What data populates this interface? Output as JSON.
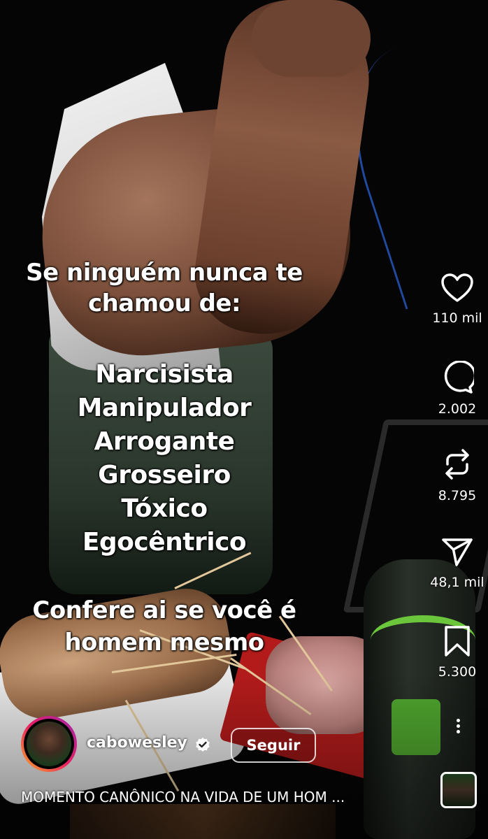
{
  "overlay": {
    "line1": "Se ninguém nunca te",
    "line2": "chamou de:",
    "list": [
      "Narcisista",
      "Manipulador",
      "Arrogante",
      "Grosseiro",
      "Tóxico",
      "Egocêntrico"
    ],
    "closing1": "Confere ai se você é",
    "closing2": "homem mesmo"
  },
  "actions": {
    "likes": "110 mil",
    "comments": "2.002",
    "reposts": "8.795",
    "shares": "48,1 mil",
    "saves": "5.300"
  },
  "author": {
    "username": "cabowesley",
    "verified": true,
    "follow_label": "Seguir"
  },
  "description": "MOMENTO CANÔNICO NA VIDA DE UM HOM ...",
  "icons": {
    "like": "heart-icon",
    "comment": "comment-icon",
    "repost": "repost-icon",
    "share": "send-icon",
    "save": "bookmark-icon",
    "more": "more-vertical-icon"
  },
  "colors": {
    "text": "#ffffff",
    "verified_badge": "#ffffff",
    "avatar_ring": "#e91e63"
  }
}
